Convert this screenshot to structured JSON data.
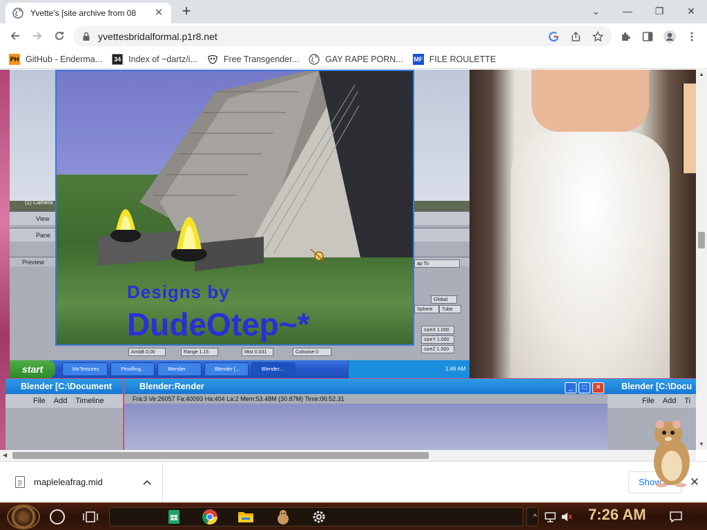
{
  "browser": {
    "tab": {
      "title": "Yvette's [site archive from 08",
      "close_glyph": "✕"
    },
    "new_tab_glyph": "+",
    "window_controls": {
      "collapse_glyph": "⌄",
      "minimize_glyph": "—",
      "restore_glyph": "❐",
      "close_glyph": "✕"
    },
    "url": "yvettesbridalformal.p1r8.net",
    "bookmarks": [
      {
        "label": "GitHub - Enderma...",
        "icon": "PH",
        "icon_bg": "#f7931e"
      },
      {
        "label": "Index of ~dartz/i...",
        "icon": "34",
        "icon_bg": "#222222"
      },
      {
        "label": "Free Transgender...",
        "icon": "mask-icon",
        "icon_bg": "#ffffff"
      },
      {
        "label": "GAY RAPE PORN...",
        "icon": "globe-icon",
        "icon_bg": "#ffffff"
      },
      {
        "label": "FILE ROULETTE",
        "icon": "MF",
        "icon_bg": "#1b4fd6"
      }
    ]
  },
  "page": {
    "blender_ui": {
      "camera_label": "(1) Camera",
      "view_label": "View",
      "panels_label": "Pane",
      "preview_label": "Preview",
      "fields": [
        "AmbB 0.00",
        "Range 1.15",
        "Mist 0.031",
        "Colnoise 0",
        "sizeX 1.000",
        "sizeY 1.000",
        "sizeZ 1.000",
        "Global",
        "Sphere",
        "Tube",
        "ap To"
      ]
    },
    "render_signature": {
      "line1": "Designs by",
      "line2": "DudeOtep~*"
    },
    "xp_taskbar": {
      "start_label": "start",
      "buttons": [
        "MxTextures",
        "Pinafling...",
        "Blender",
        "Blender [...",
        "Blender..."
      ],
      "time": "1:46 AM"
    },
    "lower_windows": [
      {
        "title": "Blender [C:\\Document",
        "menu": [
          "File",
          "Add",
          "Timeline"
        ]
      },
      {
        "title": "Blender:Render",
        "info": "Fra:3  Ve:26057 Fa:40093 Ha:404 La:2 Mem:53.48M (30.87M) Time:06:52.31"
      },
      {
        "title": "Blender [C:\\Docu",
        "menu": [
          "File",
          "Add",
          "Ti"
        ]
      }
    ]
  },
  "downloads": {
    "filename": "mapleleafrag.mid",
    "show_all_label": "Show all",
    "close_glyph": "✕"
  },
  "taskbar": {
    "time": "7:26 AM"
  },
  "colors": {
    "accent": "#1a73e8",
    "xp_blue": "#2457c9",
    "taskbar_brown": "#2c1208",
    "page_pink": "#c4547e"
  }
}
